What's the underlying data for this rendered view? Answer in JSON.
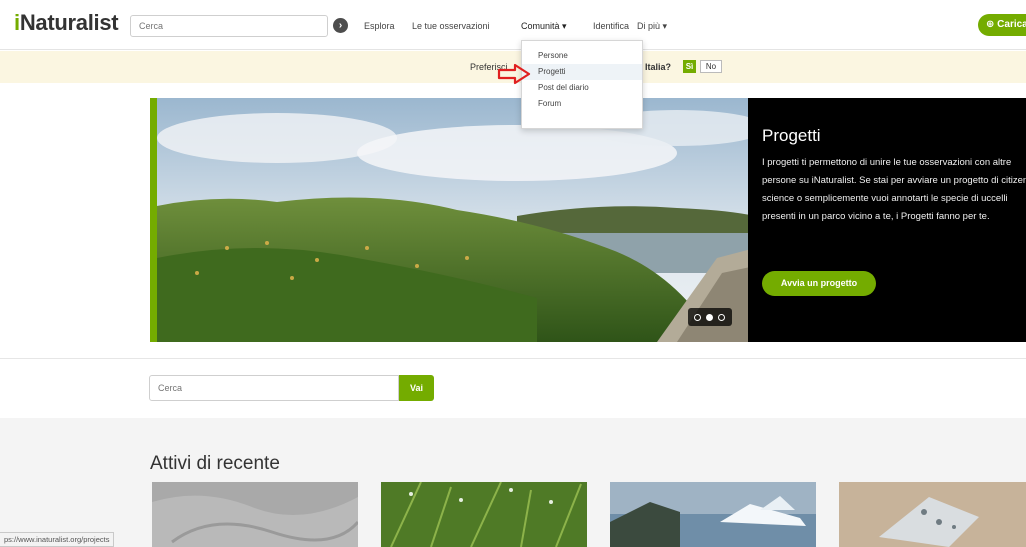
{
  "header": {
    "logo_i": "i",
    "logo_rest": "Naturalist",
    "search_placeholder": "Cerca",
    "nav": [
      "Esplora",
      "Le tue osservazioni",
      "Comunità ▾",
      "Identifica",
      "Di più ▾"
    ],
    "upload_label": "⊕ Carica"
  },
  "banner": {
    "text_left": "Preferisci",
    "text_right": "Italia?",
    "yes": "Sì",
    "no": "No"
  },
  "dropdown": {
    "items": [
      "Persone",
      "Progetti",
      "Post del diario",
      "Forum"
    ],
    "highlighted_index": 1,
    "arrow_color": "#e02020"
  },
  "hero": {
    "title": "Progetti",
    "description": "I progetti ti permettono di unire le tue osservazioni con altre persone su iNaturalist. Se stai per avviare un progetto di citizen science o semplicemente vuoi annotarti le specie di uccelli presenti in un parco vicino a te, i Progetti fanno per te.",
    "button": "Avvia un progetto",
    "carousel_active": 1
  },
  "project_search": {
    "placeholder": "Cerca",
    "button": "Vai"
  },
  "recent": {
    "title": "Attivi di recente"
  },
  "statusbar": {
    "url": "ps://www.inaturalist.org/projects"
  },
  "colors": {
    "accent": "#74ac00",
    "banner_bg": "#fbf6e1",
    "hero_panel": "#000000"
  }
}
